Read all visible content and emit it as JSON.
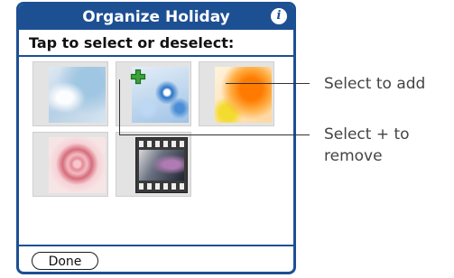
{
  "dialog": {
    "title": "Organize Holiday",
    "info_icon": "info-icon",
    "instruction": "Tap to select or deselect:",
    "done_label": "Done"
  },
  "thumbnails": [
    {
      "kind": "photo",
      "selected": false
    },
    {
      "kind": "photo",
      "selected": true,
      "badge_icon": "plus-icon"
    },
    {
      "kind": "photo",
      "selected": false
    },
    {
      "kind": "photo",
      "selected": false
    },
    {
      "kind": "video",
      "selected": false
    }
  ],
  "callouts": {
    "select_to_add": "Select to add",
    "select_plus_line1": "Select + to",
    "select_plus_line2": "remove"
  },
  "colors": {
    "accent": "#1d4f93",
    "plus_badge": "#3aa43a"
  }
}
